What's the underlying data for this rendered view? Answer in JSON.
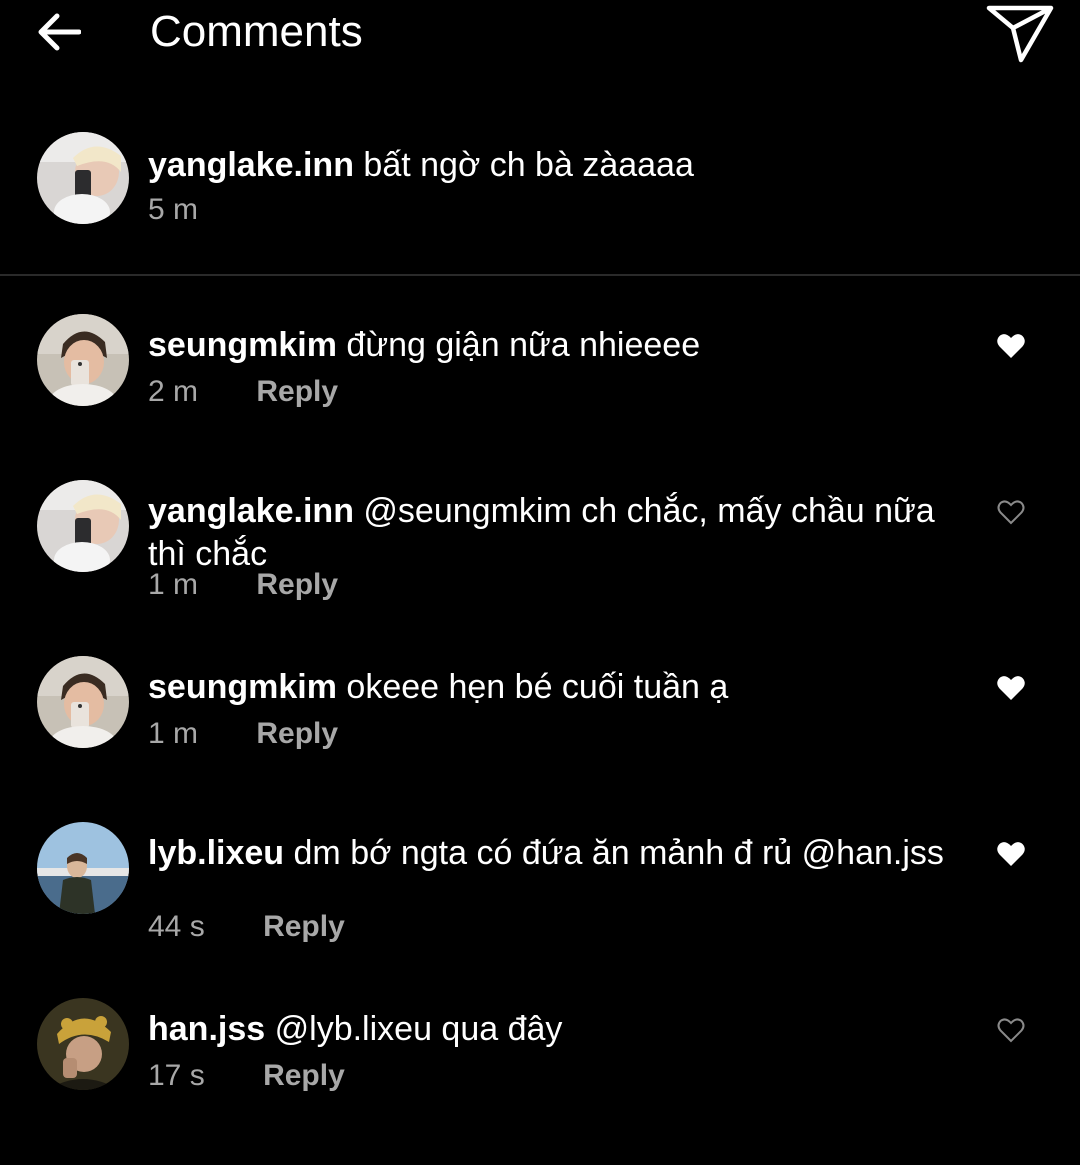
{
  "header": {
    "title": "Comments",
    "back_icon": "arrow-left-icon",
    "send_icon": "paper-plane-icon"
  },
  "caption": {
    "username": "yanglake.inn",
    "text": "bất ngờ ch bà zàaaaa",
    "time": "5 m"
  },
  "comments": [
    {
      "username": "seungmkim",
      "text": "đừng giận nữa nhieeee",
      "time": "2 m",
      "reply": "Reply",
      "liked": true
    },
    {
      "username": "yanglake.inn",
      "text": "@seungmkim ch chắc, mấy chầu nữa thì chắc",
      "time": "1 m",
      "reply": "Reply",
      "liked": false
    },
    {
      "username": "seungmkim",
      "text": "okeee hẹn bé cuối tuần ạ",
      "time": "1 m",
      "reply": "Reply",
      "liked": true
    },
    {
      "username": "lyb.lixeu",
      "text": "dm bớ ngta có đứa ăn mảnh đ rủ @han.jss",
      "time": "44 s",
      "reply": "Reply",
      "liked": true
    },
    {
      "username": "han.jss",
      "text": "@lyb.lixeu qua đây",
      "time": "17 s",
      "reply": "Reply",
      "liked": false
    }
  ],
  "colors": {
    "background": "#000000",
    "text": "#ffffff",
    "secondary": "#a8a8a8",
    "divider": "#2a2a2a"
  }
}
